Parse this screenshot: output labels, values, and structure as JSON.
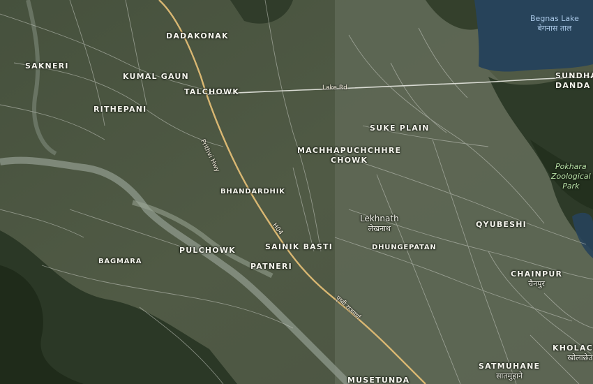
{
  "map": {
    "lake": {
      "name": "Begnas Lake",
      "name_local": "बेगनास ताल"
    },
    "park": {
      "name_line1": "Pokhara",
      "name_line2": "Zoological",
      "name_line3": "Park"
    },
    "roads": {
      "lake_rd": "Lake Rd",
      "prithvi_hwy": "Prithvi Hwy",
      "h04": "H04",
      "prithvi_local": "पृथ्वी राजमार्ग"
    },
    "places": {
      "dadakonak": "DADAKONAK",
      "sakneri": "SAKNERI",
      "kumal_gaun": "KUMAL GAUN",
      "talchowk": "TALCHOWK",
      "rithepani": "RITHEPANI",
      "suke_plain": "SUKE PLAIN",
      "machhapuchchhre_1": "MACHHAPUCHCHHRE",
      "machhapuchchhre_2": "CHOWK",
      "bhandardhik": "BHANDARDHIK",
      "lekhnath": "Lekhnath",
      "lekhnath_local": "लेखनाथ",
      "qyubeshi": "QYUBESHI",
      "dhungepatan": "DHUNGEPATAN",
      "sainik_basti": "SAINIK BASTI",
      "pulchowk": "PULCHOWK",
      "bagmara": "BAGMARA",
      "patneri": "PATNERI",
      "chainpur": "CHAINPUR",
      "chainpur_local": "चैनपुर",
      "sundha_1": "SUNDHA",
      "sundha_2": "DANDA",
      "kholachha": "KHOLACHH",
      "kholachha_local": "खोलाछेउ",
      "satmuhane": "SATMUHANE",
      "satmuhane_local": "सातमुहाने",
      "musetunda": "MUSETUNDA"
    }
  },
  "colors": {
    "terrain": "#3b4634",
    "terrain_light": "#6b7461",
    "forest": "#26331f",
    "lake": "#27435a",
    "river": "#8f9a8c",
    "highway": "#d9b772",
    "road": "#c9ccc4"
  }
}
